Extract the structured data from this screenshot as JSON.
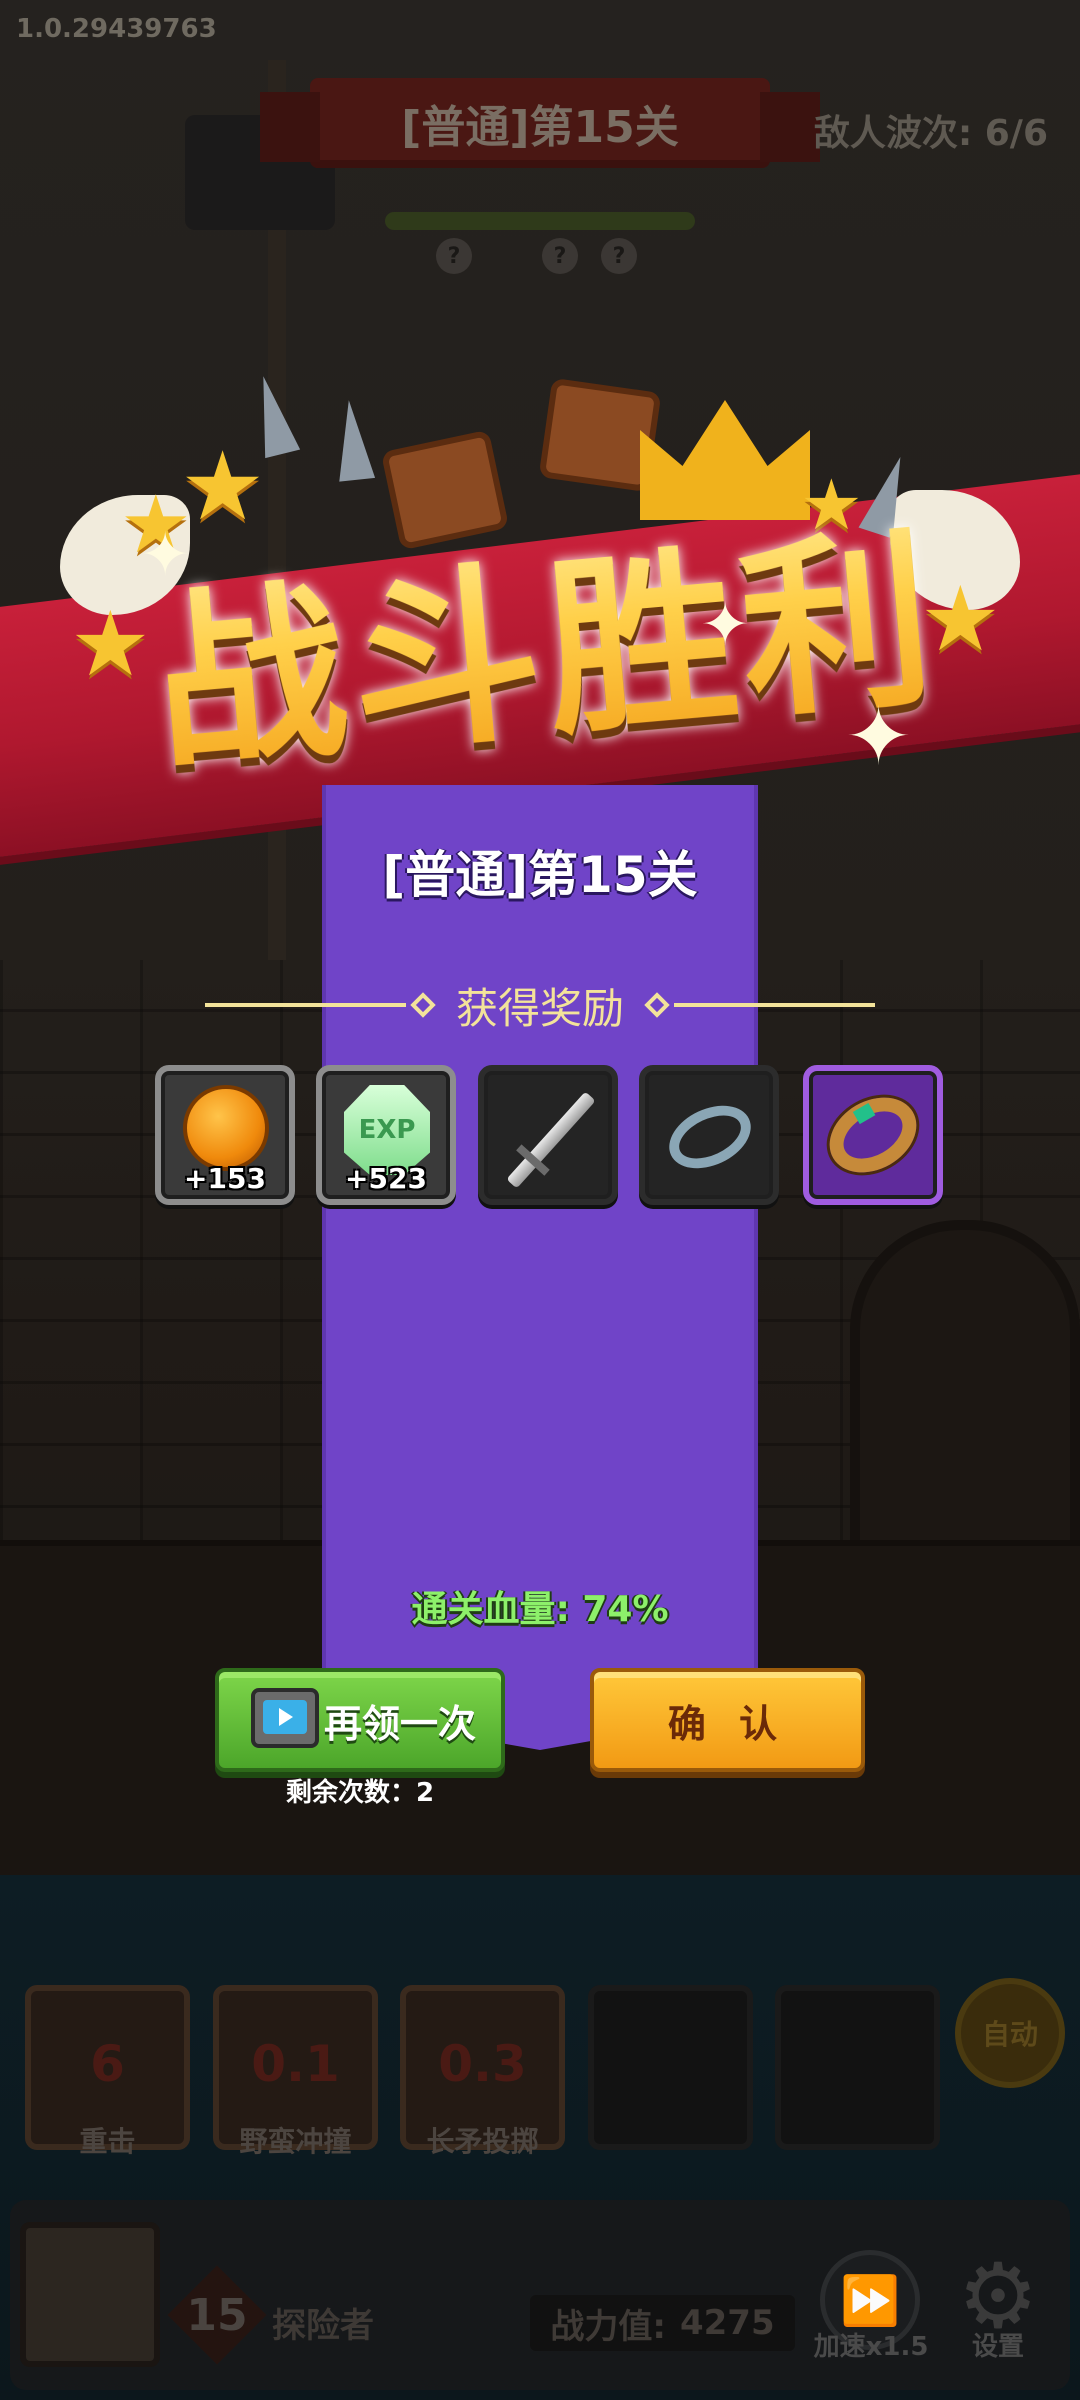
{
  "version": "1.0.29439763",
  "hud": {
    "stage_title": "[普通]第15关",
    "enemy_waves": "敌人波次: 6/6",
    "wave_markers": [
      "?",
      "?",
      "?"
    ]
  },
  "victory": {
    "title": "战斗胜利",
    "stage_title": "[普通]第15关",
    "rewards_header": "获得奖励",
    "rewards": [
      {
        "icon": "gold-coin",
        "amount": "+153",
        "rarity": "common"
      },
      {
        "icon": "exp-gem",
        "amount": "+523",
        "rarity": "common"
      },
      {
        "icon": "sword",
        "amount": "",
        "rarity": "common"
      },
      {
        "icon": "bracelet",
        "amount": "",
        "rarity": "common"
      },
      {
        "icon": "gold-ring",
        "amount": "",
        "rarity": "epic"
      }
    ],
    "hp_result": "通关血量: 74%",
    "retry_button": "再领一次",
    "remaining_text": "剩余次数：2",
    "confirm_button": "确 认"
  },
  "skills": [
    {
      "value": "6",
      "name": "重击"
    },
    {
      "value": "0.1",
      "name": "野蛮冲撞"
    },
    {
      "value": "0.3",
      "name": "长矛投掷"
    },
    {
      "value": "",
      "name": ""
    },
    {
      "value": "",
      "name": ""
    }
  ],
  "auto_button": "自动",
  "player": {
    "level": "15",
    "name": "探险者",
    "power_label": "战力值:",
    "power_value": "4275"
  },
  "speed_button": "加速x1.5",
  "settings_button": "设置",
  "colors": {
    "panel_purple": "#7044c8",
    "ribbon_red": "#c8203a",
    "title_gold": "#ffc93a",
    "retry_green": "#4ca62a",
    "confirm_orange": "#f29a14",
    "hp_green": "#8df06a",
    "header_cream": "#f3e39a"
  }
}
